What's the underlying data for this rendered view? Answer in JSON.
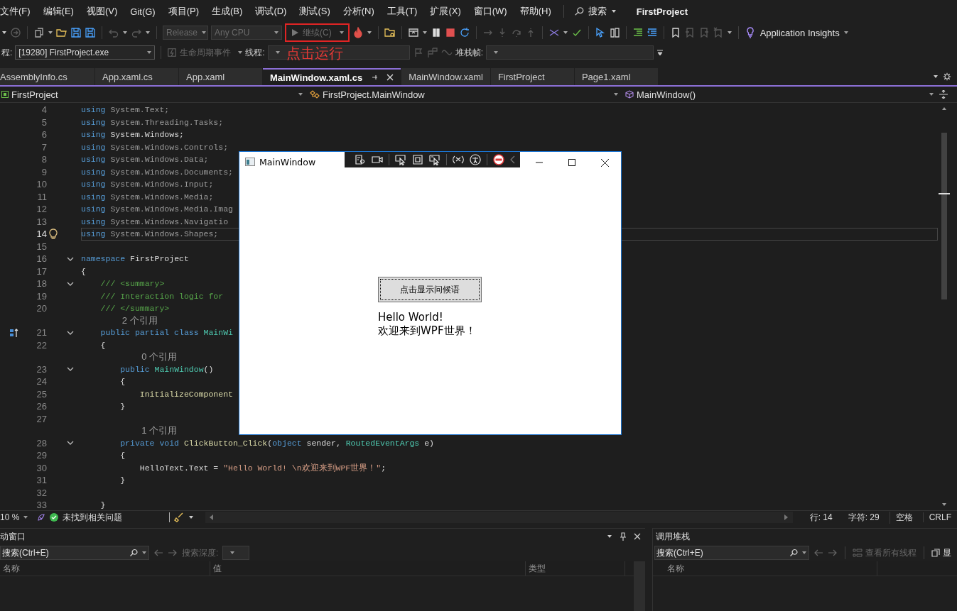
{
  "menu": {
    "items": [
      "文件(F)",
      "编辑(E)",
      "视图(V)",
      "Git(G)",
      "项目(P)",
      "生成(B)",
      "调试(D)",
      "测试(S)",
      "分析(N)",
      "工具(T)",
      "扩展(X)",
      "窗口(W)",
      "帮助(H)"
    ],
    "search": "搜索",
    "title": "FirstProject"
  },
  "toolbar": {
    "configuration": {
      "value": "Release",
      "disabled": true
    },
    "platform": {
      "value": "Any CPU",
      "disabled": true
    },
    "continue_button": {
      "label": "继续(C)",
      "disabled": true
    },
    "insights": "Application Insights"
  },
  "debug_location": {
    "process_label": "程:",
    "process": "[19280] FirstProject.exe",
    "lifecycle_events": {
      "label": "生命周期事件",
      "disabled": true
    },
    "thread_label": "线程:",
    "stack_frame_label": "堆栈帧:"
  },
  "annotation": "点击运行",
  "tabs": [
    {
      "label": "AssemblyInfo.cs",
      "selected": false
    },
    {
      "label": "App.xaml.cs",
      "selected": false
    },
    {
      "label": "App.xaml",
      "selected": false
    },
    {
      "label": "MainWindow.xaml.cs",
      "selected": true
    },
    {
      "label": "MainWindow.xaml",
      "selected": false
    },
    {
      "label": "FirstProject",
      "selected": false
    },
    {
      "label": "Page1.xaml",
      "selected": false
    }
  ],
  "nav": {
    "project": "FirstProject",
    "type": "FirstProject.MainWindow",
    "member": "MainWindow()"
  },
  "code": {
    "lines": [
      {
        "number": "4",
        "fold": false,
        "current": false,
        "marker": false,
        "tokens": [
          {
            "kind": "kw",
            "text": "using"
          },
          {
            "kind": "dim",
            "text": " System.Text;"
          }
        ]
      },
      {
        "number": "5",
        "fold": false,
        "current": false,
        "marker": false,
        "tokens": [
          {
            "kind": "kw",
            "text": "using"
          },
          {
            "kind": "dim",
            "text": " System.Threading.Tasks;"
          }
        ]
      },
      {
        "number": "6",
        "fold": false,
        "current": false,
        "marker": false,
        "tokens": [
          {
            "kind": "kw",
            "text": "using"
          },
          {
            "kind": "plain",
            "text": " System.Windows;"
          }
        ]
      },
      {
        "number": "7",
        "fold": false,
        "current": false,
        "marker": false,
        "tokens": [
          {
            "kind": "kw",
            "text": "using"
          },
          {
            "kind": "dim",
            "text": " System.Windows.Controls;"
          }
        ]
      },
      {
        "number": "8",
        "fold": false,
        "current": false,
        "marker": false,
        "tokens": [
          {
            "kind": "kw",
            "text": "using"
          },
          {
            "kind": "dim",
            "text": " System.Windows.Data;"
          }
        ]
      },
      {
        "number": "9",
        "fold": false,
        "current": false,
        "marker": false,
        "tokens": [
          {
            "kind": "kw",
            "text": "using"
          },
          {
            "kind": "dim",
            "text": " System.Windows.Documents;"
          }
        ]
      },
      {
        "number": "10",
        "fold": false,
        "current": false,
        "marker": false,
        "tokens": [
          {
            "kind": "kw",
            "text": "using"
          },
          {
            "kind": "dim",
            "text": " System.Windows.Input;"
          }
        ]
      },
      {
        "number": "11",
        "fold": false,
        "current": false,
        "marker": false,
        "tokens": [
          {
            "kind": "kw",
            "text": "using"
          },
          {
            "kind": "dim",
            "text": " System.Windows.Media;"
          }
        ]
      },
      {
        "number": "12",
        "fold": false,
        "current": false,
        "marker": false,
        "tokens": [
          {
            "kind": "kw",
            "text": "using"
          },
          {
            "kind": "dim",
            "text": " System.Windows.Media.Imag"
          }
        ]
      },
      {
        "number": "13",
        "fold": false,
        "current": false,
        "marker": false,
        "tokens": [
          {
            "kind": "kw",
            "text": "using"
          },
          {
            "kind": "dim",
            "text": " System.Windows.Navigatio"
          }
        ]
      },
      {
        "number": "14",
        "fold": false,
        "current": true,
        "marker": false,
        "tokens": [
          {
            "kind": "kw",
            "text": "using"
          },
          {
            "kind": "dim",
            "text": " System.Windows.Shapes;"
          }
        ]
      },
      {
        "number": "15",
        "fold": false,
        "current": false,
        "marker": false
      },
      {
        "number": "16",
        "fold": true,
        "current": false,
        "marker": false,
        "tokens": [
          {
            "kind": "kw",
            "text": "namespace"
          },
          {
            "kind": "plain",
            "text": " FirstProject"
          }
        ]
      },
      {
        "number": "17",
        "fold": false,
        "current": false,
        "marker": false,
        "tokens": [
          {
            "kind": "plain",
            "text": "{"
          }
        ]
      },
      {
        "number": "18",
        "fold": true,
        "current": false,
        "marker": false,
        "tokens": [
          {
            "kind": "comment",
            "text": "    /// <summary>"
          }
        ]
      },
      {
        "number": "19",
        "fold": false,
        "current": false,
        "marker": false,
        "tokens": [
          {
            "kind": "comment",
            "text": "    /// Interaction logic for"
          }
        ]
      },
      {
        "number": "20",
        "fold": false,
        "current": false,
        "marker": false,
        "tokens": [
          {
            "kind": "comment",
            "text": "    /// </summary>"
          }
        ]
      },
      {
        "kind": "lens",
        "text": "2 个引用"
      },
      {
        "number": "21",
        "fold": true,
        "current": false,
        "marker": true,
        "tokens": [
          {
            "kind": "kw",
            "text": "    public partial class"
          },
          {
            "kind": "type",
            "text": " MainWi"
          }
        ]
      },
      {
        "number": "22",
        "fold": false,
        "current": false,
        "marker": false,
        "tokens": [
          {
            "kind": "plain",
            "text": "    {"
          }
        ]
      },
      {
        "kind": "lens",
        "text": "0 个引用"
      },
      {
        "number": "23",
        "fold": true,
        "current": false,
        "marker": false,
        "tokens": [
          {
            "kind": "kw",
            "text": "        public"
          },
          {
            "kind": "type",
            "text": " MainWindow"
          },
          {
            "kind": "plain",
            "text": "()"
          }
        ]
      },
      {
        "number": "24",
        "fold": false,
        "current": false,
        "marker": false,
        "tokens": [
          {
            "kind": "plain",
            "text": "        {"
          }
        ]
      },
      {
        "number": "25",
        "fold": false,
        "current": false,
        "marker": false,
        "tokens": [
          {
            "kind": "method",
            "text": "            InitializeComponent"
          }
        ]
      },
      {
        "number": "26",
        "fold": false,
        "current": false,
        "marker": false,
        "tokens": [
          {
            "kind": "plain",
            "text": "        }"
          }
        ]
      },
      {
        "number": "27",
        "fold": false,
        "current": false,
        "marker": false
      },
      {
        "kind": "lens",
        "text": "1 个引用"
      },
      {
        "number": "28",
        "fold": true,
        "current": false,
        "marker": false,
        "tokens": [
          {
            "kind": "kw",
            "text": "        private void"
          },
          {
            "kind": "method",
            "text": " ClickButton_Click"
          },
          {
            "kind": "plain",
            "text": "("
          },
          {
            "kind": "kw",
            "text": "object"
          },
          {
            "kind": "plain",
            "text": " sender, "
          },
          {
            "kind": "type",
            "text": "RoutedEventArgs"
          },
          {
            "kind": "plain",
            "text": " e)"
          }
        ]
      },
      {
        "number": "29",
        "fold": false,
        "current": false,
        "marker": false,
        "tokens": [
          {
            "kind": "plain",
            "text": "        {"
          }
        ]
      },
      {
        "number": "30",
        "fold": false,
        "current": false,
        "marker": false,
        "tokens": [
          {
            "kind": "plain",
            "text": "            HelloText.Text = "
          },
          {
            "kind": "string",
            "text": "\"Hello World! \\n欢迎来到WPF世界！\""
          },
          {
            "kind": "plain",
            "text": ";"
          }
        ]
      },
      {
        "number": "31",
        "fold": false,
        "current": false,
        "marker": false,
        "tokens": [
          {
            "kind": "plain",
            "text": "        }"
          }
        ]
      },
      {
        "number": "32",
        "fold": false,
        "current": false,
        "marker": false
      },
      {
        "number": "33",
        "fold": false,
        "current": false,
        "marker": false,
        "tokens": [
          {
            "kind": "plain",
            "text": "    }"
          }
        ]
      }
    ]
  },
  "editor_status": {
    "zoom": "10 %",
    "issues": "未找到相关问题",
    "line": "行: 14",
    "column": "字符: 29",
    "indent": "空格",
    "line_ending": "CRLF"
  },
  "autos_panel": {
    "title": "动窗口",
    "search_placeholder": "搜索(Ctrl+E)",
    "search_depth_label": "搜索深度:",
    "columns": [
      "名称",
      "值",
      "类型"
    ]
  },
  "call_stack_panel": {
    "title": "调用堆栈",
    "search_placeholder": "搜索(Ctrl+E)",
    "show_threads": "查看所有线程",
    "cut_button": "显",
    "columns": [
      "名称"
    ]
  },
  "app_window": {
    "title": "MainWindow",
    "button": "点击显示问候语",
    "message_lines": [
      "Hello World!",
      "欢迎来到WPF世界！"
    ]
  }
}
